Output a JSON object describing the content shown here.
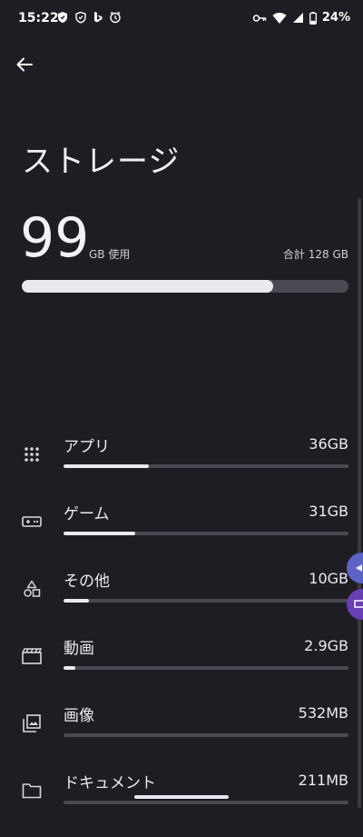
{
  "status_bar": {
    "time": "15:22",
    "battery": "24%"
  },
  "header": {
    "title": "ストレージ"
  },
  "summary": {
    "used_value": "99",
    "used_unit": "GB 使用",
    "total_text": "合計 128 GB",
    "used_fraction": 0.77
  },
  "categories": [
    {
      "label": "アプリ",
      "size": "36GB",
      "icon": "apps-grid-icon",
      "fraction": 0.3
    },
    {
      "label": "ゲーム",
      "size": "31GB",
      "icon": "gamepad-icon",
      "fraction": 0.25
    },
    {
      "label": "その他",
      "size": "10GB",
      "icon": "shapes-icon",
      "fraction": 0.09
    },
    {
      "label": "動画",
      "size": "2.9GB",
      "icon": "video-icon",
      "fraction": 0.04
    },
    {
      "label": "画像",
      "size": "532MB",
      "icon": "image-icon",
      "fraction": 0.0
    },
    {
      "label": "ドキュメント",
      "size": "211MB",
      "icon": "folder-icon",
      "fraction": 0.0
    }
  ],
  "colors": {
    "background": "#1f1d24",
    "bar_track": "#4a4850",
    "bar_fill": "#ebe8f0",
    "float_blue": "#5b64c4",
    "float_purple": "#6a3fb3"
  }
}
